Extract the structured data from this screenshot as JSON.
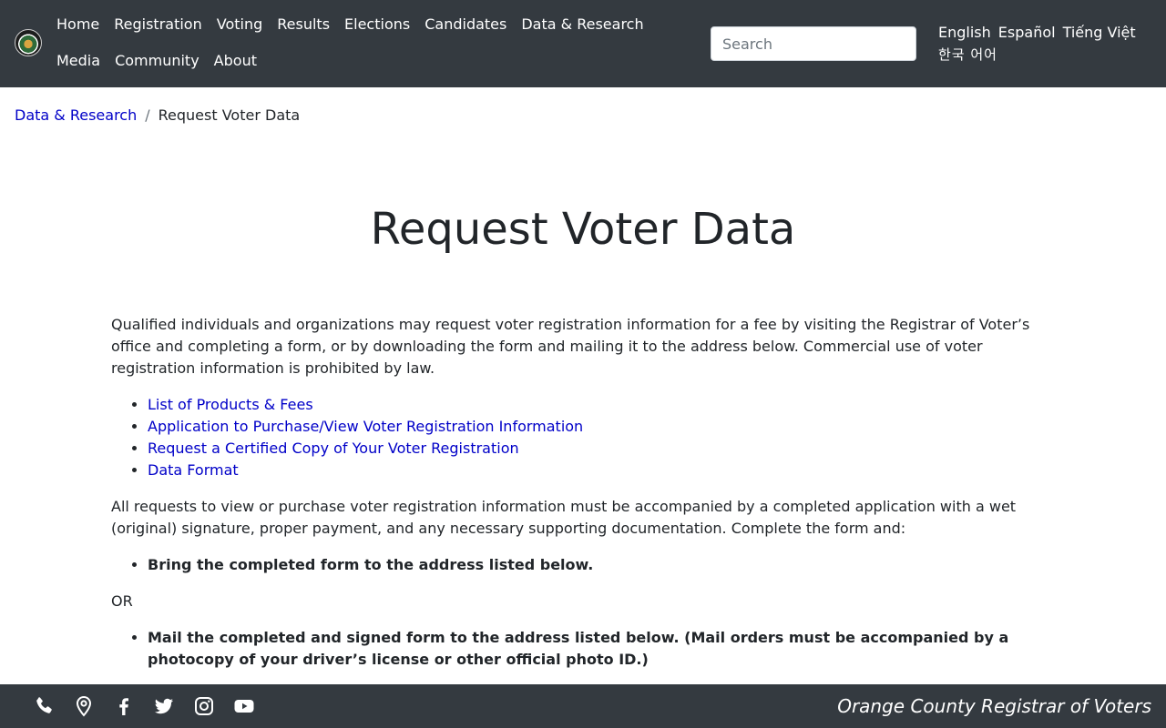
{
  "header": {
    "nav": [
      {
        "label": "Home"
      },
      {
        "label": "Registration"
      },
      {
        "label": "Voting"
      },
      {
        "label": "Results"
      },
      {
        "label": "Elections"
      },
      {
        "label": "Candidates"
      },
      {
        "label": "Data & Research"
      },
      {
        "label": "Media"
      },
      {
        "label": "Community"
      },
      {
        "label": "About"
      }
    ],
    "search": {
      "placeholder": "Search",
      "value": ""
    },
    "languages": [
      "English",
      "Español",
      "Tiếng Việt",
      "한국 어어"
    ]
  },
  "breadcrumb": {
    "parent": "Data & Research",
    "separator": "/",
    "current": "Request Voter Data"
  },
  "main": {
    "title": "Request Voter Data",
    "intro": "Qualified individuals and organizations may request voter registration information for a fee by visiting the Registrar of Voter’s office and completing a form, or by downloading the form and mailing it to the address below. Commercial use of voter registration information is prohibited by law.",
    "links": [
      "List of Products & Fees",
      "Application to Purchase/View Voter Registration Information",
      "Request a Certified Copy of Your Voter Registration",
      "Data Format"
    ],
    "requirements": "All requests to view or purchase voter registration information must be accompanied by a completed application with a wet (original) signature, proper payment, and any necessary supporting documentation. Complete the form and:",
    "option_bring": "Bring the completed form to the address listed below.",
    "or_text": "OR",
    "option_mail": "Mail the completed and signed form to the address listed below. (Mail orders must be accompanied by a photocopy of your driver’s license or other official photo ID.)"
  },
  "footer": {
    "icons": [
      "phone-icon",
      "map-pin-icon",
      "facebook-icon",
      "twitter-icon",
      "instagram-icon",
      "youtube-icon"
    ],
    "title": "Orange County Registrar of Voters"
  },
  "colors": {
    "navbar_bg": "#343a40",
    "link": "#0000c8",
    "text": "#212529"
  }
}
